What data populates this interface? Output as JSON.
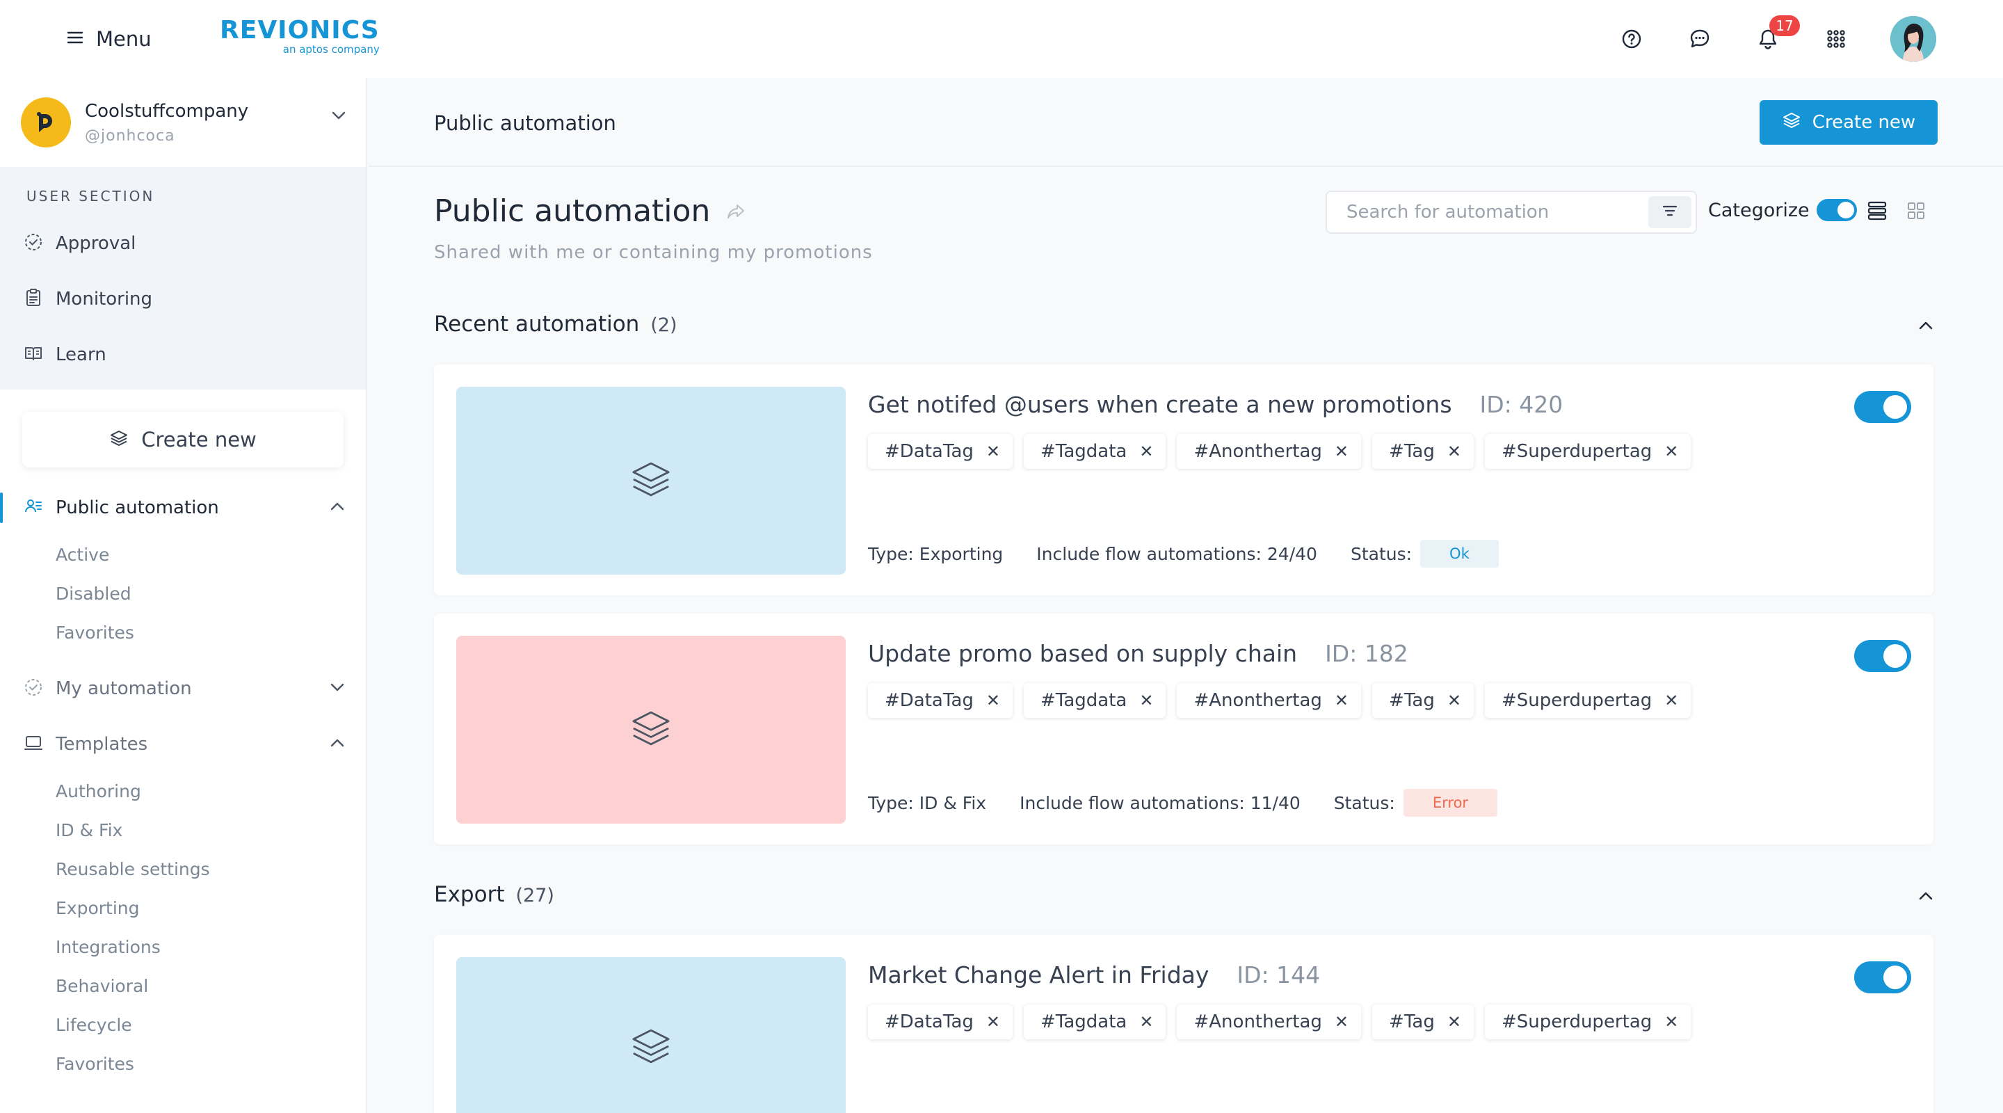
{
  "header": {
    "menu_label": "Menu",
    "logo_main": "REVIONICS",
    "logo_sub": "an aptos company",
    "notification_count": "17",
    "icons": [
      "help-icon",
      "chat-icon",
      "bell-icon",
      "apps-grid-icon",
      "user-avatar"
    ]
  },
  "account": {
    "name": "Coolstuffcompany",
    "handle": "@jonhcoca"
  },
  "sidebar": {
    "section_label": "USER SECTION",
    "user_items": [
      {
        "label": "Approval",
        "icon": "approval-icon"
      },
      {
        "label": "Monitoring",
        "icon": "clipboard-icon"
      },
      {
        "label": "Learn",
        "icon": "book-icon"
      }
    ],
    "create_label": "Create new",
    "groups": [
      {
        "label": "Public automation",
        "icon": "users-icon",
        "expanded": true,
        "active": true,
        "items": [
          "Active",
          "Disabled",
          "Favorites"
        ]
      },
      {
        "label": "My automation",
        "icon": "approval-icon",
        "expanded": false,
        "active": false,
        "items": []
      },
      {
        "label": "Templates",
        "icon": "laptop-icon",
        "expanded": true,
        "active": false,
        "items": [
          "Authoring",
          "ID & Fix",
          "Reusable settings",
          "Exporting",
          "Integrations",
          "Behavioral",
          "Lifecycle",
          "Favorites"
        ]
      }
    ]
  },
  "main": {
    "breadcrumb": "Public automation",
    "create_button": "Create new",
    "title": "Public automation",
    "subtitle": "Shared with me or containing my promotions",
    "search_placeholder": "Search for automation",
    "categorize_label": "Categorize",
    "categorize_on": true,
    "sections": [
      {
        "title": "Recent automation",
        "count": "(2)"
      },
      {
        "title": "Export",
        "count": "(27)"
      }
    ],
    "cards": [
      {
        "title": "Get notifed @users when create a new promotions",
        "id": "ID: 420",
        "thumb_color": "#cfe9f7",
        "tags": [
          "#DataTag",
          "#Tagdata",
          "#Anonthertag",
          "#Tag",
          "#Superdupertag"
        ],
        "type": "Type: Exporting",
        "flows": "Include flow automations: 24/40",
        "status_label": "Status:",
        "status": "Ok",
        "status_bg": "#e9f2f7",
        "status_fg": "#1594d6",
        "enabled": true
      },
      {
        "title": "Update promo based on supply chain",
        "id": "ID: 182",
        "thumb_color": "#fdd1d1",
        "tags": [
          "#DataTag",
          "#Tagdata",
          "#Anonthertag",
          "#Tag",
          "#Superdupertag"
        ],
        "type": "Type: ID & Fix",
        "flows": "Include flow automations: 11/40",
        "status_label": "Status:",
        "status": "Error",
        "status_bg": "#fde6e1",
        "status_fg": "#ef6a4f",
        "enabled": true
      },
      {
        "title": "Market Change Alert in Friday",
        "id": "ID: 144",
        "thumb_color": "#cfe9f7",
        "tags": [
          "#DataTag",
          "#Tagdata",
          "#Anonthertag",
          "#Tag",
          "#Superdupertag"
        ],
        "enabled": true
      }
    ]
  },
  "colors": {
    "accent": "#1594d6",
    "sidebar_section_bg": "#f1f5f9",
    "badge": "#ef4444"
  }
}
